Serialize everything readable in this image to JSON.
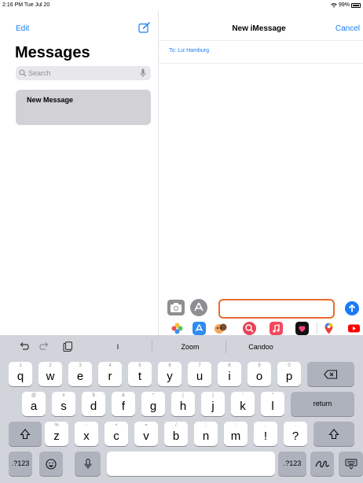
{
  "status_bar": {
    "time": "2:16 PM  Tue Jul 20",
    "battery": "99%",
    "icons": [
      "wifi-icon",
      "battery-icon"
    ]
  },
  "left_pane": {
    "edit_label": "Edit",
    "title": "Messages",
    "search": {
      "placeholder": "Search"
    },
    "conversations": [
      {
        "label": "New Message",
        "selected": true
      }
    ],
    "icons": [
      "compose-icon",
      "search-icon",
      "mic-icon"
    ]
  },
  "right_pane": {
    "title": "New iMessage",
    "cancel_label": "Cancel",
    "to_field": "To: Liz Hamburg",
    "message_input": {
      "value": ""
    },
    "icons": [
      "camera-icon",
      "app-store-icon",
      "send-arrow-icon"
    ],
    "app_strip": [
      "photos-app-icon",
      "app-store-app-icon",
      "memoji-app-icon",
      "image-search-app-icon",
      "music-app-icon",
      "digital-touch-app-icon",
      "maps-app-icon",
      "youtube-app-icon"
    ]
  },
  "keyboard": {
    "toolbar_icons": [
      "undo-icon",
      "redo-icon",
      "clipboard-icon"
    ],
    "suggestions": [
      "I",
      "Zoom",
      "Candoo"
    ],
    "row1": [
      {
        "main": "q",
        "alt": "1"
      },
      {
        "main": "w",
        "alt": "2"
      },
      {
        "main": "e",
        "alt": "3"
      },
      {
        "main": "r",
        "alt": "4"
      },
      {
        "main": "t",
        "alt": "5"
      },
      {
        "main": "y",
        "alt": "6"
      },
      {
        "main": "u",
        "alt": "7"
      },
      {
        "main": "i",
        "alt": "8"
      },
      {
        "main": "o",
        "alt": "9"
      },
      {
        "main": "p",
        "alt": "0"
      }
    ],
    "row2": [
      {
        "main": "a",
        "alt": "@"
      },
      {
        "main": "s",
        "alt": "#"
      },
      {
        "main": "d",
        "alt": "$"
      },
      {
        "main": "f",
        "alt": "&"
      },
      {
        "main": "g",
        "alt": "*"
      },
      {
        "main": "h",
        "alt": "("
      },
      {
        "main": "j",
        "alt": ")"
      },
      {
        "main": "k",
        "alt": "'"
      },
      {
        "main": "l",
        "alt": "\""
      }
    ],
    "row3": [
      {
        "main": "z",
        "alt": "%"
      },
      {
        "main": "x",
        "alt": "-"
      },
      {
        "main": "c",
        "alt": "+"
      },
      {
        "main": "v",
        "alt": "="
      },
      {
        "main": "b",
        "alt": "/"
      },
      {
        "main": "n",
        "alt": ";"
      },
      {
        "main": "m",
        "alt": ":"
      },
      {
        "main": "!",
        "alt": ","
      },
      {
        "main": "?",
        "alt": "."
      }
    ],
    "return_label": "return",
    "numbers_label": ".?123",
    "colors": {
      "key": "#ffffff",
      "dark_key": "#aeb2bc",
      "background": "#d2d4db"
    }
  },
  "colors": {
    "accent": "#1a7cf5",
    "input_highlight": "#e86c2c",
    "selected_row": "#d1d1d6"
  }
}
